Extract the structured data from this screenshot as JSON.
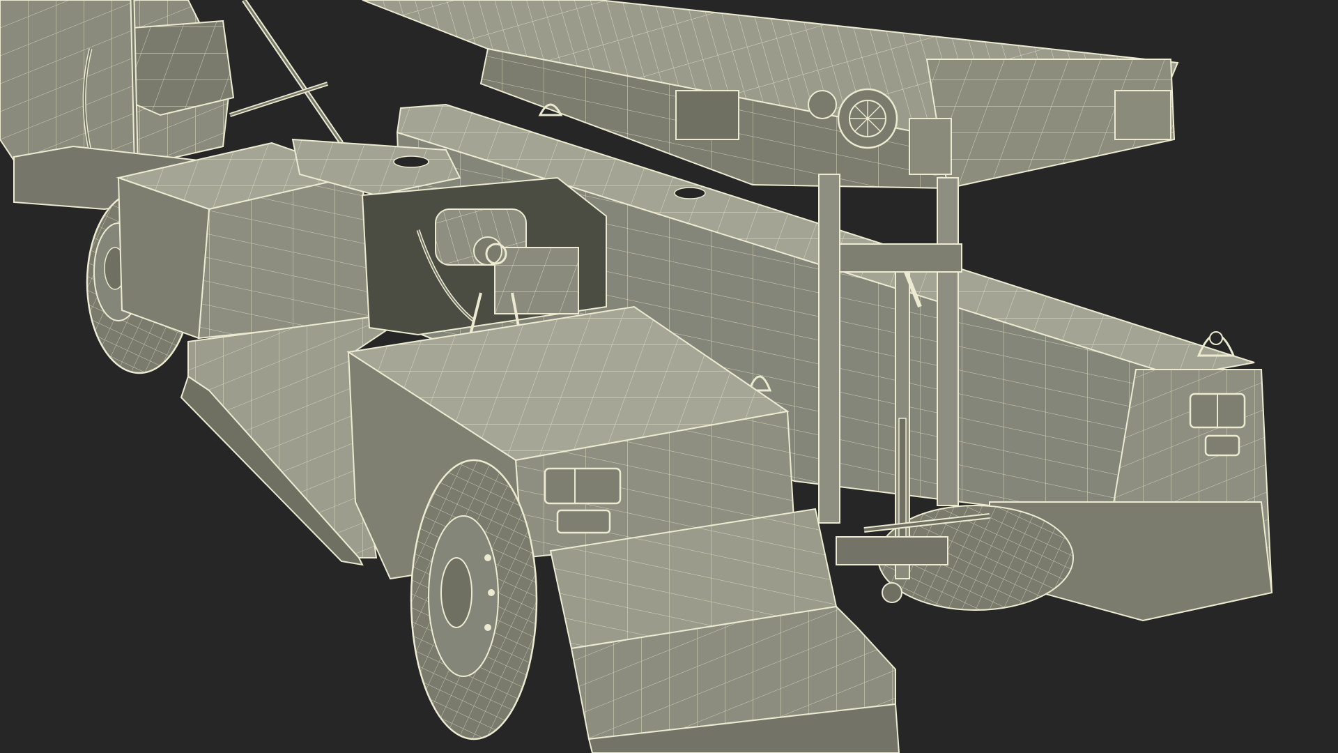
{
  "scene": {
    "subject": "belt-loader-vehicle",
    "render_style": "wireframe-over-shaded",
    "colors": {
      "background": "#262626",
      "surface": "#8f9080",
      "surface_light": "#a2a393",
      "surface_dark": "#6f7062",
      "surface_shadow": "#55574b",
      "wire": "#ecebd2"
    }
  }
}
